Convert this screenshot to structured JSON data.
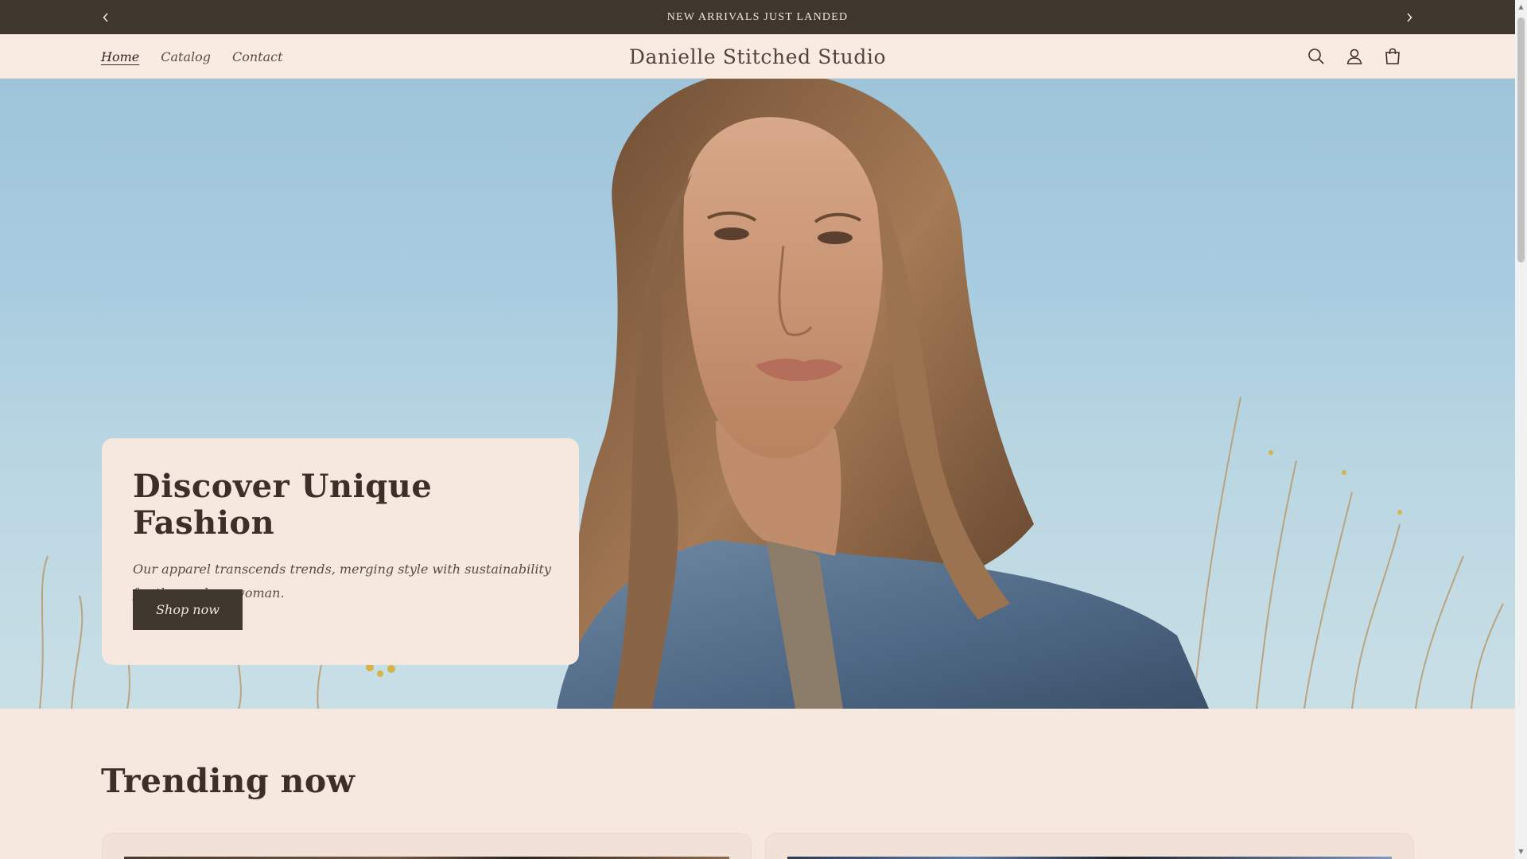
{
  "announcement": {
    "message": "NEW ARRIVALS JUST LANDED",
    "prev_icon": "chevron-left-icon",
    "next_icon": "chevron-right-icon"
  },
  "header": {
    "brand": "Danielle Stitched Studio",
    "nav": [
      {
        "label": "Home",
        "active": true
      },
      {
        "label": "Catalog",
        "active": false
      },
      {
        "label": "Contact",
        "active": false
      }
    ],
    "icons": [
      "search-icon",
      "account-icon",
      "cart-icon"
    ]
  },
  "hero": {
    "title": "Discover Unique Fashion",
    "text": "Our apparel transcends trends, merging style with sustainability for the modern woman.",
    "button_label": "Shop now"
  },
  "trending": {
    "title": "Trending now"
  },
  "colors": {
    "dark": "#3f362e",
    "background": "#f6e8df",
    "card": "#f7e8df"
  }
}
